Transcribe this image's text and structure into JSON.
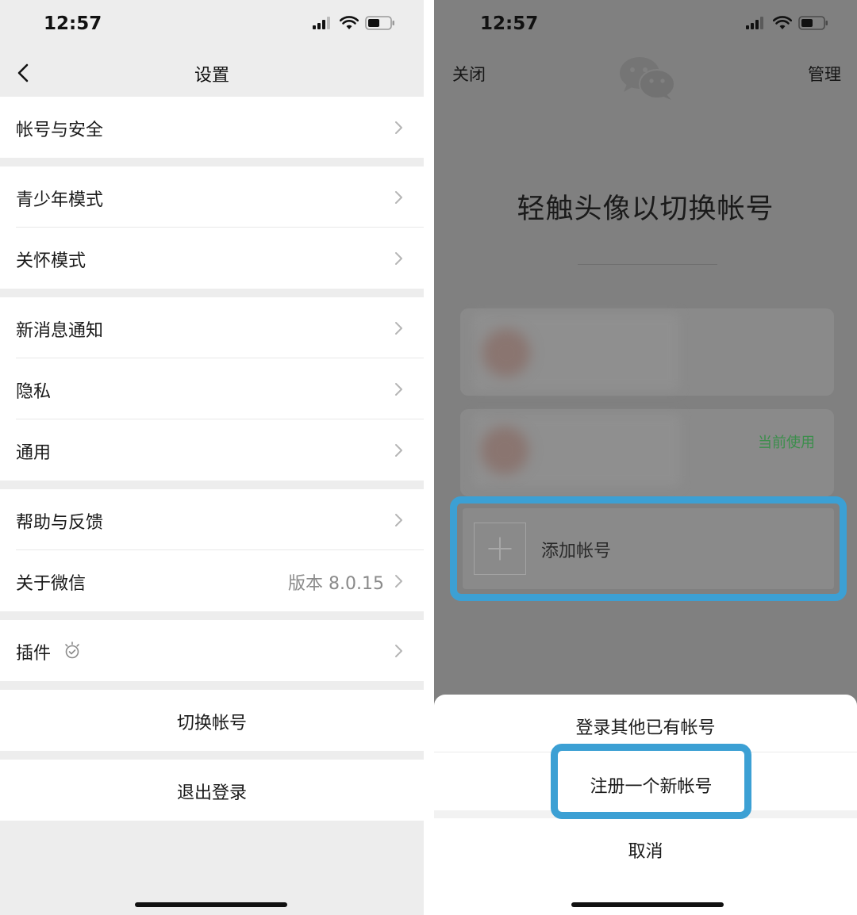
{
  "left": {
    "status": {
      "time": "12:57"
    },
    "nav": {
      "title": "设置"
    },
    "items": {
      "account_security": "帐号与安全",
      "youth_mode": "青少年模式",
      "care_mode": "关怀模式",
      "notifications": "新消息通知",
      "privacy": "隐私",
      "general": "通用",
      "help_feedback": "帮助与反馈",
      "about": "关于微信",
      "about_value": "版本 8.0.15",
      "plugins": "插件"
    },
    "switch_account": "切换帐号",
    "logout": "退出登录"
  },
  "right": {
    "status": {
      "time": "12:57"
    },
    "close": "关闭",
    "manage": "管理",
    "heading": "轻触头像以切换帐号",
    "current_tag": "当前使用",
    "add_account": "添加帐号",
    "sheet": {
      "login_other": "登录其他已有帐号",
      "register_new": "注册一个新帐号",
      "cancel": "取消"
    }
  },
  "colors": {
    "highlight": "#3ca0d4",
    "current_tag": "#3c8e4c",
    "overlay": "#808080",
    "settings_bg": "#ededed"
  },
  "icons": [
    "back-chevron-icon",
    "chevron-right-icon",
    "plugin-bulb-icon",
    "wechat-logo-icon",
    "plus-icon",
    "signal-icon",
    "wifi-icon",
    "battery-icon"
  ]
}
